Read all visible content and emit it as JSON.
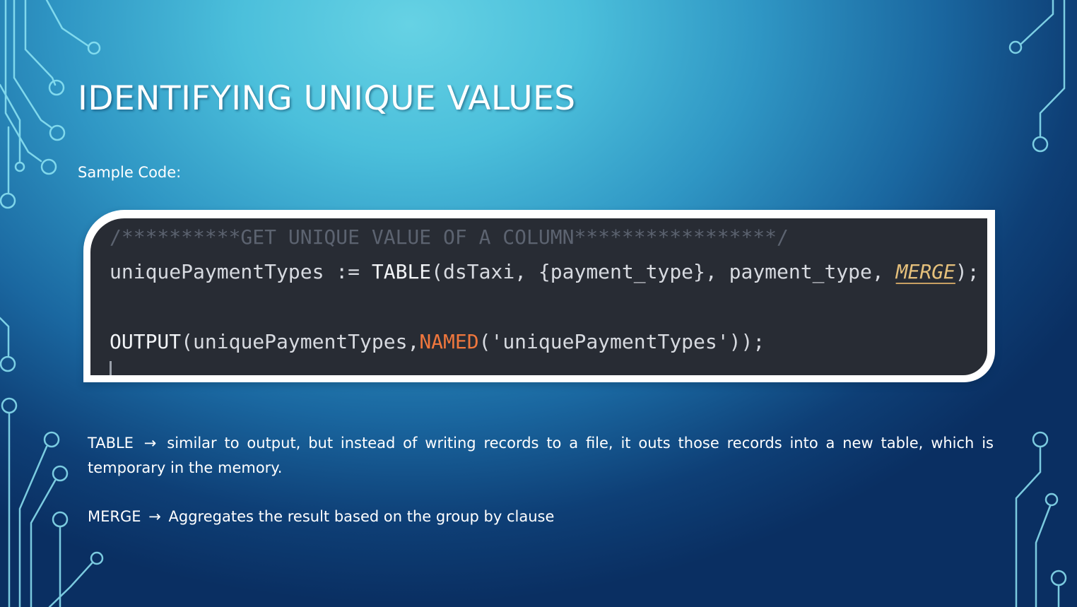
{
  "slide": {
    "title": "IDENTIFYING UNIQUE VALUES",
    "sample_label": "Sample Code:"
  },
  "code": {
    "line1_comment": "/**********GET UNIQUE VALUE OF A COLUMN*****************/",
    "line2": {
      "var": "uniquePaymentTypes := ",
      "func": "TABLE",
      "args": "(dsTaxi, {payment_type}, payment_type, ",
      "flag": "MERGE",
      "end": ");"
    },
    "line4": {
      "func": "OUTPUT",
      "arg1": "(uniquePaymentTypes,",
      "named": "NAMED",
      "arg2": "('uniquePaymentTypes'));"
    }
  },
  "notes": [
    {
      "term": "TABLE",
      "arrow": "→",
      "text": "similar to output, but instead of writing records to a file, it outs those records into a new table, which is temporary in the memory."
    },
    {
      "term": "MERGE",
      "arrow": "→",
      "text": "Aggregates the result based on the group by clause"
    }
  ],
  "colors": {
    "code_background": "#282c34",
    "comment": "#5c6370",
    "keyword_orange": "#f0773d",
    "keyword_merge": "#e5c07b",
    "circuit_lines": "#8fe6f5"
  }
}
